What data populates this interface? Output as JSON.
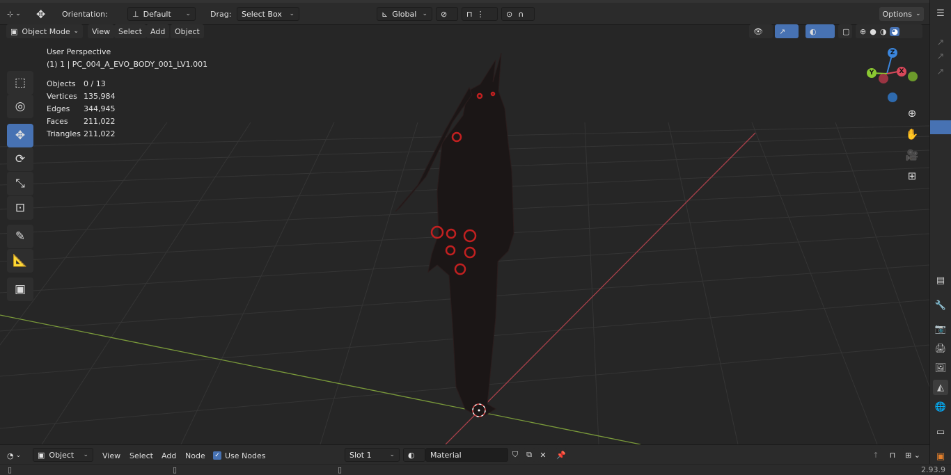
{
  "header": {
    "orientation_label": "Orientation:",
    "orientation_value": "Default",
    "drag_label": "Drag:",
    "drag_value": "Select Box",
    "transform_space": "Global",
    "options_label": "Options"
  },
  "viewport_header": {
    "mode": "Object Mode",
    "menus": [
      "View",
      "Select",
      "Add",
      "Object"
    ]
  },
  "overlay": {
    "perspective": "User Perspective",
    "active_object": "(1) 1 | PC_004_A_EVO_BODY_001_LV1.001",
    "stats": [
      {
        "label": "Objects",
        "value": "0 / 13"
      },
      {
        "label": "Vertices",
        "value": "135,984"
      },
      {
        "label": "Edges",
        "value": "344,945"
      },
      {
        "label": "Faces",
        "value": "211,022"
      },
      {
        "label": "Triangles",
        "value": "211,022"
      }
    ]
  },
  "gizmo": {
    "x": "X",
    "y": "Y",
    "z": "Z"
  },
  "node_editor_header": {
    "type": "Object",
    "menus": [
      "View",
      "Select",
      "Add",
      "Node"
    ],
    "use_nodes_label": "Use Nodes",
    "slot": "Slot 1",
    "material": "Material"
  },
  "status": {
    "version": "2.93.9"
  },
  "colors": {
    "accent": "#4772b3",
    "x_axis": "#d8485a",
    "y_axis": "#8bc832",
    "z_axis": "#3b86dd"
  }
}
